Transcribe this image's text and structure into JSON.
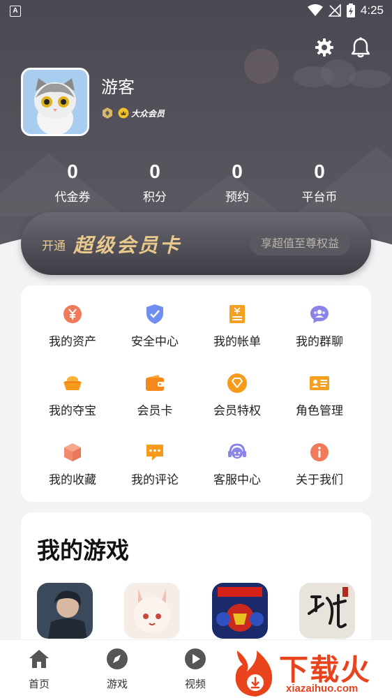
{
  "status": {
    "time": "4:25",
    "app_icon": "A"
  },
  "header": {
    "settings_icon": "gear-icon",
    "notifications_icon": "bell-icon"
  },
  "profile": {
    "name": "游客",
    "member_level": "大众会员"
  },
  "stats": [
    {
      "value": "0",
      "label": "代金券"
    },
    {
      "value": "0",
      "label": "积分"
    },
    {
      "value": "0",
      "label": "预约"
    },
    {
      "value": "0",
      "label": "平台币"
    }
  ],
  "vip": {
    "prefix": "开通",
    "title": "超级会员卡",
    "button": "享超值至尊权益"
  },
  "menu": [
    {
      "label": "我的资产",
      "icon": "yen-icon",
      "color": "#f07a5a"
    },
    {
      "label": "安全中心",
      "icon": "shield-icon",
      "color": "#6f8ef0"
    },
    {
      "label": "我的帐单",
      "icon": "bill-icon",
      "color": "#f5a020"
    },
    {
      "label": "我的群聊",
      "icon": "chat-group-icon",
      "color": "#8a84ea"
    },
    {
      "label": "我的夺宝",
      "icon": "treasure-icon",
      "color": "#f59a1a"
    },
    {
      "label": "会员卡",
      "icon": "wallet-icon",
      "color": "#f58a1a"
    },
    {
      "label": "会员特权",
      "icon": "diamond-icon",
      "color": "#f59a1a"
    },
    {
      "label": "角色管理",
      "icon": "id-card-icon",
      "color": "#f5a020"
    },
    {
      "label": "我的收藏",
      "icon": "cube-icon",
      "color": "#f08a6a"
    },
    {
      "label": "我的评论",
      "icon": "comment-icon",
      "color": "#f59a1a"
    },
    {
      "label": "客服中心",
      "icon": "headset-icon",
      "color": "#8a84ea"
    },
    {
      "label": "关于我们",
      "icon": "info-icon",
      "color": "#f07a5a"
    }
  ],
  "games": {
    "title": "我的游戏"
  },
  "tabs": [
    {
      "label": "首页",
      "icon": "home-icon"
    },
    {
      "label": "游戏",
      "icon": "compass-icon"
    },
    {
      "label": "视频",
      "icon": "play-icon"
    }
  ],
  "watermark": {
    "text": "下载火",
    "url": "xiazaihuo.com"
  }
}
